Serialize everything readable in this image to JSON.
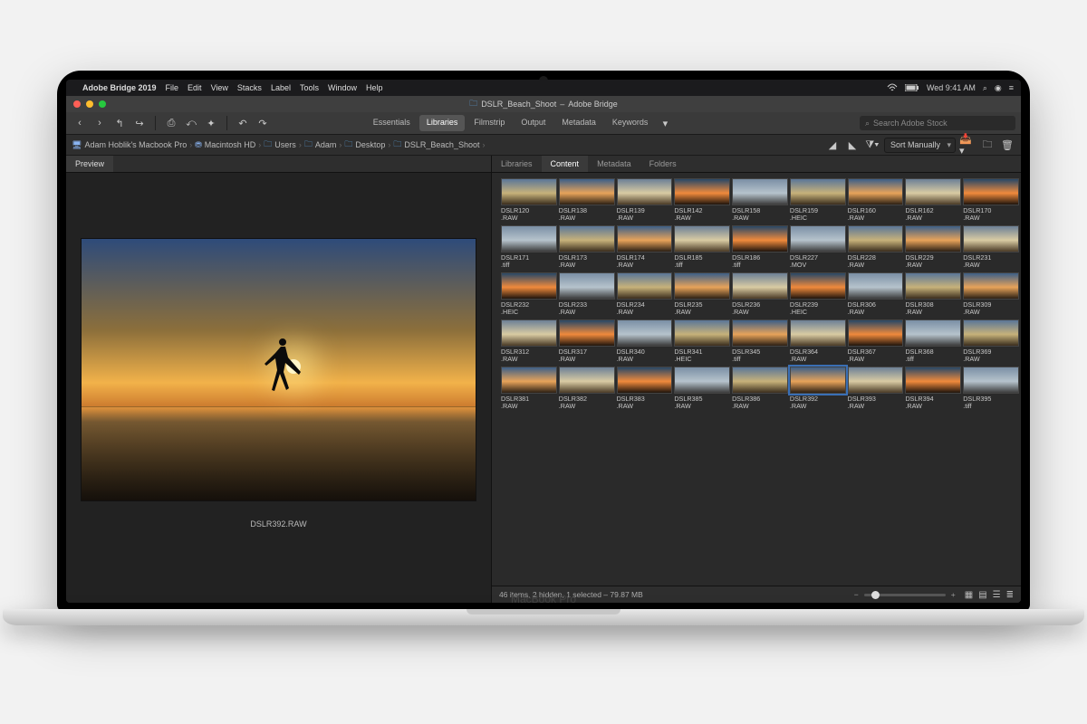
{
  "mac_menu": {
    "app": "Adobe Bridge 2019",
    "items": [
      "File",
      "Edit",
      "View",
      "Stacks",
      "Label",
      "Tools",
      "Window",
      "Help"
    ],
    "clock": "Wed 9:41 AM"
  },
  "window": {
    "title_folder": "DSLR_Beach_Shoot",
    "title_app": "Adobe Bridge"
  },
  "workspaces": {
    "items": [
      "Essentials",
      "Libraries",
      "Filmstrip",
      "Output",
      "Metadata",
      "Keywords"
    ],
    "active": "Libraries"
  },
  "search": {
    "placeholder": "Search Adobe Stock"
  },
  "breadcrumb": {
    "computer": "Adam Hoblik's Macbook Pro",
    "segments": [
      "Macintosh HD",
      "Users",
      "Adam",
      "Desktop",
      "DSLR_Beach_Shoot"
    ]
  },
  "sort": {
    "label": "Sort Manually"
  },
  "left_panel": {
    "tab": "Preview",
    "filename": "DSLR392.RAW"
  },
  "right_panel": {
    "tabs": [
      "Libraries",
      "Content",
      "Metadata",
      "Folders"
    ],
    "active": "Content"
  },
  "status": {
    "text": "46 items, 2 hidden, 1 selected – 79.87 MB"
  },
  "thumbnails": [
    {
      "n": "DSLR120",
      "e": ".RAW"
    },
    {
      "n": "DSLR138",
      "e": ".RAW"
    },
    {
      "n": "DSLR139",
      "e": ".RAW"
    },
    {
      "n": "DSLR142",
      "e": ".RAW"
    },
    {
      "n": "DSLR158",
      "e": ".RAW"
    },
    {
      "n": "DSLR159",
      "e": ".HEIC"
    },
    {
      "n": "DSLR160",
      "e": ".RAW"
    },
    {
      "n": "DSLR162",
      "e": ".RAW"
    },
    {
      "n": "DSLR170",
      "e": ".RAW"
    },
    {
      "n": "DSLR171",
      "e": ".tiff"
    },
    {
      "n": "DSLR173",
      "e": ".RAW"
    },
    {
      "n": "DSLR174",
      "e": ".RAW"
    },
    {
      "n": "DSLR185",
      "e": ".tiff"
    },
    {
      "n": "DSLR186",
      "e": ".tiff"
    },
    {
      "n": "DSLR227",
      "e": ".MOV"
    },
    {
      "n": "DSLR228",
      "e": ".RAW"
    },
    {
      "n": "DSLR229",
      "e": ".RAW"
    },
    {
      "n": "DSLR231",
      "e": ".RAW"
    },
    {
      "n": "DSLR232",
      "e": ".HEIC"
    },
    {
      "n": "DSLR233",
      "e": ".RAW"
    },
    {
      "n": "DSLR234",
      "e": ".RAW"
    },
    {
      "n": "DSLR235",
      "e": ".RAW"
    },
    {
      "n": "DSLR236",
      "e": ".RAW"
    },
    {
      "n": "DSLR239",
      "e": ".HEIC"
    },
    {
      "n": "DSLR306",
      "e": ".RAW"
    },
    {
      "n": "DSLR308",
      "e": ".RAW"
    },
    {
      "n": "DSLR309",
      "e": ".RAW"
    },
    {
      "n": "DSLR312",
      "e": ".RAW"
    },
    {
      "n": "DSLR317",
      "e": ".RAW"
    },
    {
      "n": "DSLR340",
      "e": ".RAW"
    },
    {
      "n": "DSLR341",
      "e": ".HEIC"
    },
    {
      "n": "DSLR345",
      "e": ".tiff"
    },
    {
      "n": "DSLR364",
      "e": ".RAW"
    },
    {
      "n": "DSLR367",
      "e": ".RAW"
    },
    {
      "n": "DSLR368",
      "e": ".tiff"
    },
    {
      "n": "DSLR369",
      "e": ".RAW"
    },
    {
      "n": "DSLR381",
      "e": ".RAW"
    },
    {
      "n": "DSLR382",
      "e": ".RAW"
    },
    {
      "n": "DSLR383",
      "e": ".RAW"
    },
    {
      "n": "DSLR385",
      "e": ".RAW"
    },
    {
      "n": "DSLR386",
      "e": ".RAW"
    },
    {
      "n": "DSLR392",
      "e": ".RAW",
      "selected": true
    },
    {
      "n": "DSLR393",
      "e": ".RAW"
    },
    {
      "n": "DSLR394",
      "e": ".RAW"
    },
    {
      "n": "DSLR395",
      "e": ".tiff"
    }
  ],
  "laptop_brand": "MacBook Pro"
}
